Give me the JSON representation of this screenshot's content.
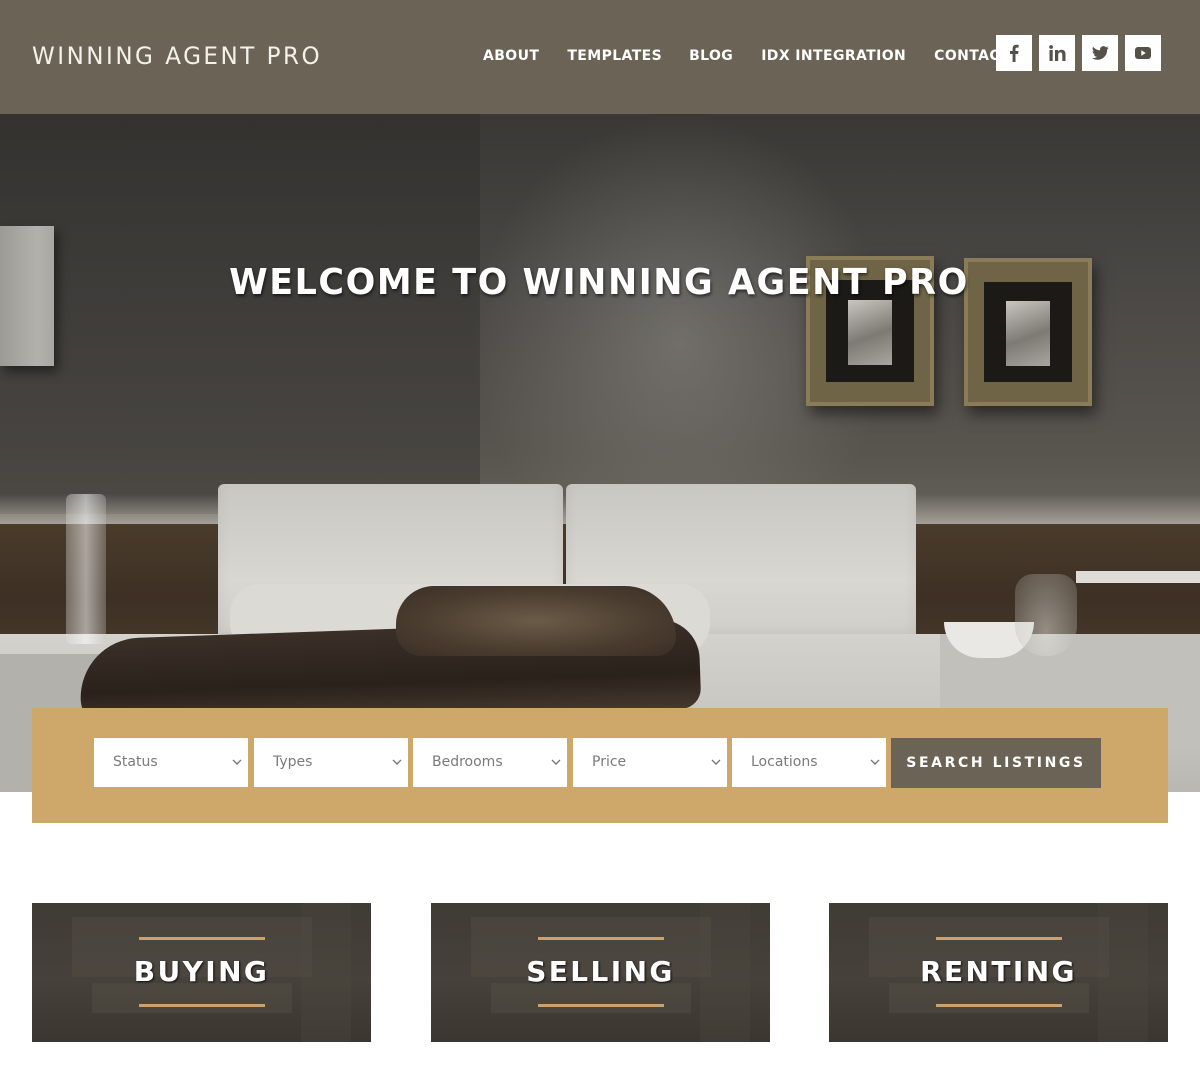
{
  "header": {
    "site_title": "WINNING AGENT PRO",
    "nav": [
      {
        "label": "ABOUT"
      },
      {
        "label": "TEMPLATES"
      },
      {
        "label": "BLOG"
      },
      {
        "label": "IDX INTEGRATION"
      },
      {
        "label": "CONTACT"
      }
    ],
    "social": [
      {
        "name": "facebook",
        "icon": "facebook-icon",
        "glyph": "f"
      },
      {
        "name": "linkedin",
        "icon": "linkedin-icon",
        "glyph": "in"
      },
      {
        "name": "twitter",
        "icon": "twitter-icon"
      },
      {
        "name": "youtube",
        "icon": "youtube-icon"
      }
    ]
  },
  "hero": {
    "title": "WELCOME TO WINNING AGENT PRO"
  },
  "search": {
    "fields": [
      {
        "name": "status",
        "value": "Status"
      },
      {
        "name": "types",
        "value": "Types"
      },
      {
        "name": "bedrooms",
        "value": "Bedrooms"
      },
      {
        "name": "price",
        "value": "Price"
      },
      {
        "name": "locations",
        "value": "Locations"
      }
    ],
    "button_label": "SEARCH LISTINGS"
  },
  "cards": [
    {
      "label": "BUYING"
    },
    {
      "label": "SELLING"
    },
    {
      "label": "RENTING"
    }
  ],
  "colors": {
    "header_bg": "#6b6456",
    "accent_gold": "#cea86b",
    "button_bg": "#6b6456",
    "text_light": "#ffffff"
  }
}
